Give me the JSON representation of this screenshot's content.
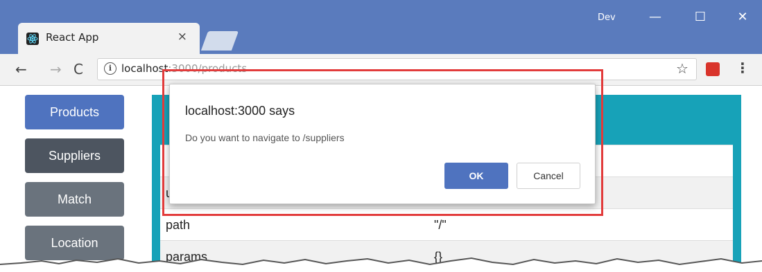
{
  "browser": {
    "tab_title": "React App",
    "tab_close": "×",
    "profile": "Dev",
    "window_buttons": [
      "—",
      "☐",
      "✕"
    ],
    "nav": {
      "back": "←",
      "forward": "→",
      "reload": "C"
    },
    "url_host": "localhost",
    "url_rest": ":3000/products",
    "star": "☆",
    "menu": "⋮"
  },
  "sidebar": {
    "buttons": [
      "Products",
      "Suppliers",
      "Match",
      "Location"
    ]
  },
  "table": {
    "rows": [
      {
        "key": "u",
        "value": ""
      },
      {
        "key": "path",
        "value": "\"/\""
      },
      {
        "key": "params",
        "value": "{}"
      }
    ]
  },
  "dialog": {
    "title": "localhost:3000 says",
    "message": "Do you want to navigate to /suppliers",
    "ok": "OK",
    "cancel": "Cancel"
  },
  "colors": {
    "titlebar": "#5a7bbd",
    "primary": "#4f73bf",
    "dark": "#4d5560",
    "secondary": "#6a737d",
    "info": "#17a2b8",
    "highlight": "#e23b3b"
  }
}
